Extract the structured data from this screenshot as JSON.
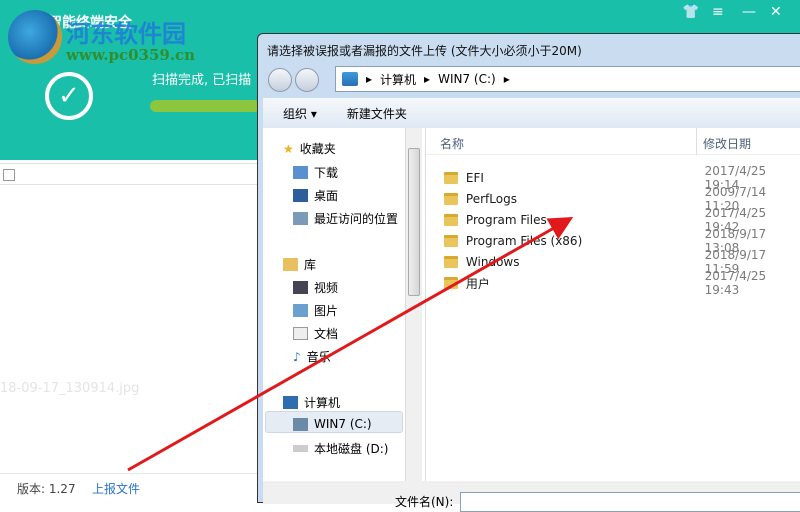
{
  "app": {
    "title": "智能终端安全",
    "scan_status": "扫描完成, 已扫描",
    "version": "版本: 1.27",
    "upload_link": "上报文件",
    "faded_file": "18-09-17_130914.jpg",
    "progress_percent": 100
  },
  "watermark": {
    "name": "河东软件园",
    "url": "www.pc0359.cn"
  },
  "dialog": {
    "title": "请选择被误报或者漏报的文件上传 (文件大小必须小于20M)",
    "breadcrumb": [
      "计算机",
      "WIN7 (C:)"
    ],
    "toolbar": {
      "organize": "组织 ▾",
      "new_folder": "新建文件夹"
    },
    "nav": {
      "favorites": "收藏夹",
      "downloads": "下载",
      "desktop": "桌面",
      "recent": "最近访问的位置",
      "libraries": "库",
      "videos": "视频",
      "pictures": "图片",
      "documents": "文档",
      "music": "音乐",
      "computer": "计算机",
      "drive_c": "WIN7 (C:)",
      "drive_d": "本地磁盘 (D:)"
    },
    "columns": {
      "name": "名称",
      "date": "修改日期"
    },
    "files": [
      {
        "name": "EFI",
        "date": "2017/4/25 19:14"
      },
      {
        "name": "PerfLogs",
        "date": "2009/7/14 11:20"
      },
      {
        "name": "Program Files",
        "date": "2017/4/25 19:42"
      },
      {
        "name": "Program Files (x86)",
        "date": "2018/9/17 13:08"
      },
      {
        "name": "Windows",
        "date": "2018/9/17 11:59"
      },
      {
        "name": "用户",
        "date": "2017/4/25 19:43"
      }
    ],
    "filename_label": "文件名(N):"
  }
}
